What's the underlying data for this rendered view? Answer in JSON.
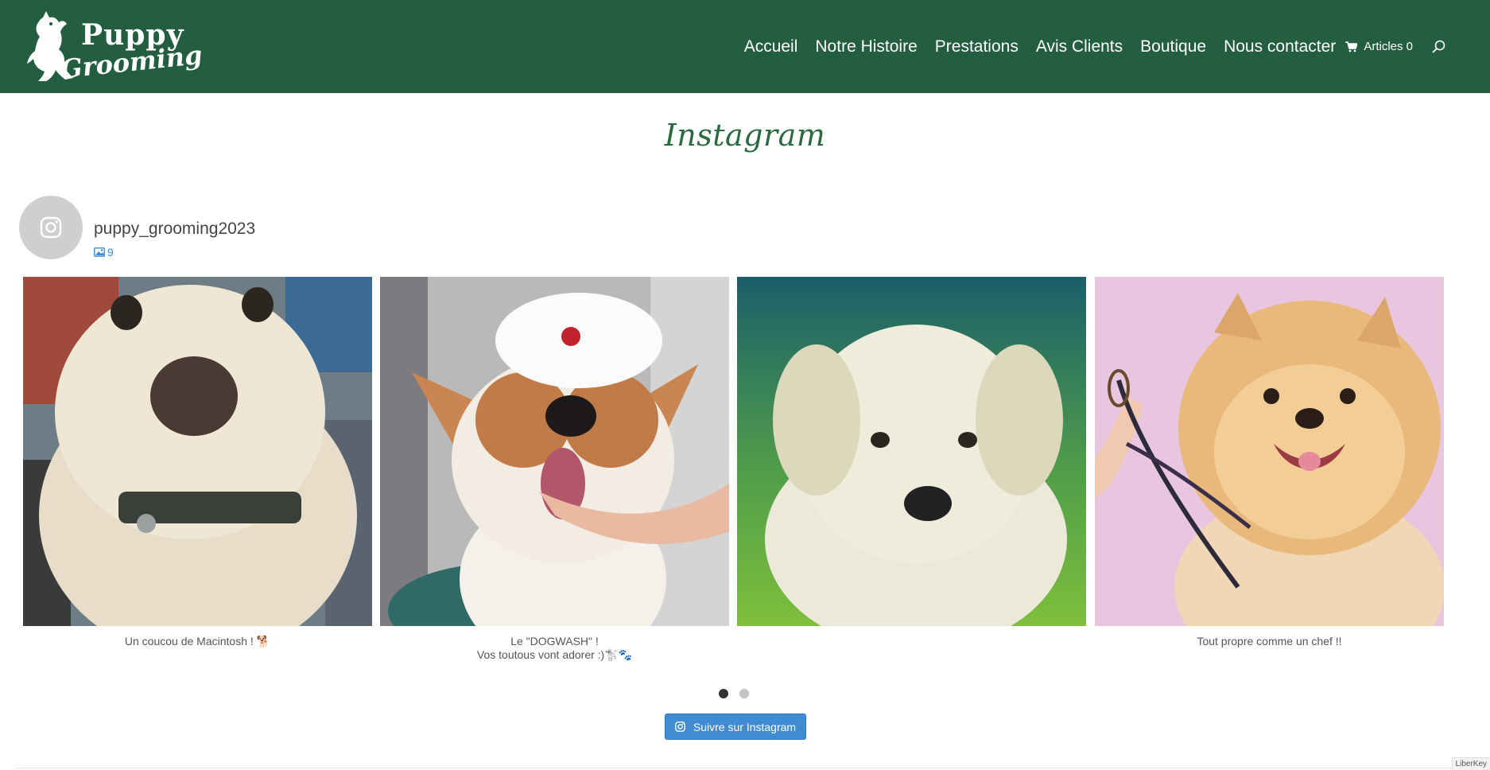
{
  "brand": {
    "logo_top": "Puppy",
    "logo_bottom": "Grooming"
  },
  "nav": {
    "items": [
      {
        "label": "Accueil"
      },
      {
        "label": "Notre Histoire"
      },
      {
        "label": "Prestations"
      },
      {
        "label": "Avis Clients"
      },
      {
        "label": "Boutique"
      },
      {
        "label": "Nous contacter"
      }
    ],
    "cart_label": "Articles 0",
    "cart_icon": "cart-icon",
    "search_icon": "search-icon"
  },
  "page": {
    "title": "Instagram"
  },
  "profile": {
    "username": "puppy_grooming2023",
    "post_count": "9",
    "avatar_icon": "instagram-icon"
  },
  "posts": [
    {
      "caption": "Un coucou de Macintosh ! 🐕"
    },
    {
      "caption_line1": "Le \"DOGWASH\" !",
      "caption_line2": "Vos toutous vont adorer :)🐩🐾"
    },
    {
      "caption": ""
    },
    {
      "caption": "Tout propre comme un chef !!"
    }
  ],
  "carousel": {
    "active_page": 1,
    "page_count": 2
  },
  "follow_button": {
    "label": "Suivre sur Instagram"
  },
  "footer": {
    "corner_text": "LiberKey"
  },
  "colors": {
    "header_bg": "#235e41",
    "title": "#2a6a3f",
    "link": "#3a89d6",
    "button": "#408bd1"
  }
}
